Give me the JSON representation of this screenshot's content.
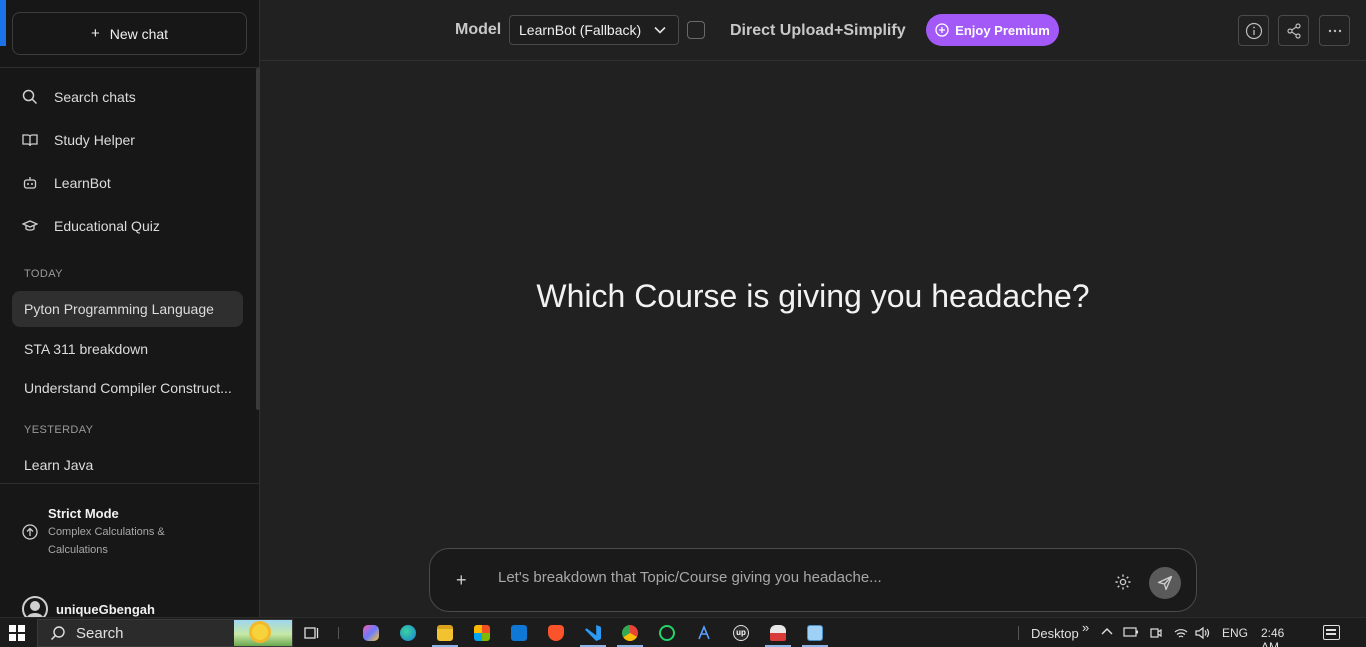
{
  "sidebar": {
    "new_chat_label": "New chat",
    "nav": [
      {
        "label": "Search chats",
        "icon": "search-icon"
      },
      {
        "label": "Study Helper",
        "icon": "book-icon"
      },
      {
        "label": "LearnBot",
        "icon": "robot-icon"
      },
      {
        "label": "Educational Quiz",
        "icon": "graduation-cap-icon"
      }
    ],
    "sections": [
      {
        "label": "TODAY",
        "chats": [
          "Pyton Programming Language",
          "STA 311 breakdown",
          "Understand Compiler Construct..."
        ]
      },
      {
        "label": "YESTERDAY",
        "chats": [
          "Learn Java"
        ]
      }
    ],
    "active_chat": "Pyton Programming Language",
    "strict_mode": {
      "title": "Strict Mode",
      "description": "Complex Calculations & Calculations"
    },
    "user": {
      "name": "uniqueGbengah"
    }
  },
  "header": {
    "model_label": "Model",
    "model_selected": "LearnBot (Fallback)",
    "direct_upload_label": "Direct Upload+Simplify",
    "premium_label": "Enjoy Premium",
    "accent_color": "#a259f7"
  },
  "main": {
    "headline": "Which Course is giving you headache?",
    "composer_placeholder": "Let's breakdown that Topic/Course giving you headache..."
  },
  "taskbar": {
    "search_label": "Search",
    "desktop_label": "Desktop",
    "language": "ENG",
    "time": "2:46 AM",
    "pinned_apps": [
      "copilot-icon",
      "edge-icon",
      "file-explorer-icon",
      "microsoft-store-icon",
      "outlook-icon",
      "brave-icon",
      "vscode-icon",
      "chrome-icon",
      "whatsapp-icon",
      "app-a-icon",
      "upwork-icon",
      "app-car-icon",
      "notepad-icon"
    ]
  }
}
